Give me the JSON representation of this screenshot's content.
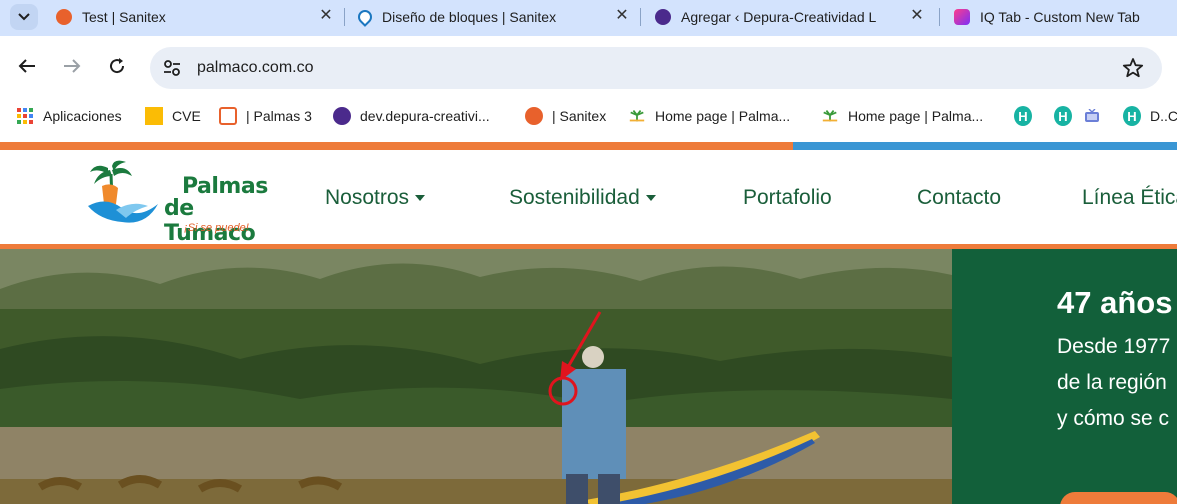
{
  "browser": {
    "tabs": [
      {
        "title": "Test | Sanitex",
        "favicon_color": "#e8612c"
      },
      {
        "title": "Diseño de bloques | Sanitex",
        "favicon_color": "#1b77c0"
      },
      {
        "title": "Agregar ‹ Depura-Creatividad L",
        "favicon_color": "#4b2a8c"
      },
      {
        "title": "IQ Tab - Custom New Tab",
        "favicon_color": "#7b2ff7"
      }
    ],
    "address": "palmaco.com.co",
    "bookmarks": [
      {
        "label": "Aplicaciones",
        "icon": "apps-grid-icon"
      },
      {
        "label": "CVE",
        "icon": "folder-icon"
      },
      {
        "label": "| Palmas 3",
        "icon": "palmas-icon"
      },
      {
        "label": "dev.depura-creativi...",
        "icon": "depura-icon"
      },
      {
        "label": "| Sanitex",
        "icon": "sanitex-icon"
      },
      {
        "label": "Home page | Palma...",
        "icon": "palm-icon"
      },
      {
        "label": "Home page | Palma...",
        "icon": "palm-icon"
      },
      {
        "label": "",
        "icon": "h-icon"
      },
      {
        "label": "",
        "icon": "h-icon"
      },
      {
        "label": "",
        "icon": "tv-icon"
      },
      {
        "label": "D..C",
        "icon": "h-icon"
      }
    ]
  },
  "site": {
    "logo": {
      "line1": "Palmas",
      "line2": "de Tumaco",
      "tagline": "¡Si se puede!"
    },
    "nav": [
      {
        "label": "Nosotros",
        "dropdown": true
      },
      {
        "label": "Sostenibilidad",
        "dropdown": true
      },
      {
        "label": "Portafolio",
        "dropdown": false
      },
      {
        "label": "Contacto",
        "dropdown": false
      },
      {
        "label": "Línea Ética",
        "dropdown": false
      }
    ],
    "panel": {
      "title": "47 años",
      "lines": [
        "Desde 1977",
        "de la región",
        "y cómo se c"
      ]
    }
  },
  "colors": {
    "brand_green": "#12603a",
    "nav_green": "#1a5e3a",
    "brand_orange": "#ee7b3a",
    "brand_blue": "#3a96d4",
    "annotation_red": "#e0141e"
  }
}
